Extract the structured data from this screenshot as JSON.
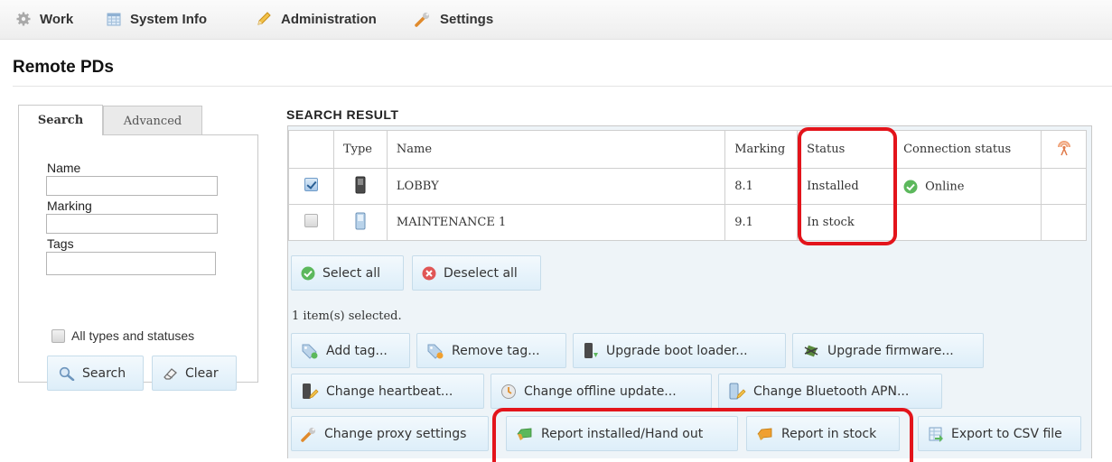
{
  "nav": {
    "items": [
      {
        "label": "Work",
        "icon": "gear-icon"
      },
      {
        "label": "System Info",
        "icon": "calendar-icon"
      },
      {
        "label": "Administration",
        "icon": "pencil-icon"
      },
      {
        "label": "Settings",
        "icon": "wrench-icon"
      }
    ]
  },
  "page": {
    "title": "Remote PDs"
  },
  "search_panel": {
    "tabs": [
      "Search",
      "Advanced"
    ],
    "fields": [
      {
        "label": "Name",
        "value": ""
      },
      {
        "label": "Marking",
        "value": ""
      },
      {
        "label": "Tags",
        "value": ""
      }
    ],
    "all_types_label": "All types and statuses",
    "search_button": "Search",
    "clear_button": "Clear"
  },
  "results": {
    "title": "SEARCH RESULT",
    "columns": [
      "Type",
      "Name",
      "Marking",
      "Status",
      "Connection status"
    ],
    "rows": [
      {
        "checked": true,
        "name": "LOBBY",
        "marking": "8.1",
        "status": "Installed",
        "connection": "Online"
      },
      {
        "checked": false,
        "name": "MAINTENANCE 1",
        "marking": "9.1",
        "status": "In stock",
        "connection": ""
      }
    ],
    "select_all": "Select all",
    "deselect_all": "Deselect all",
    "selected_text": "1 item(s) selected.",
    "actions": {
      "add_tag": "Add tag...",
      "remove_tag": "Remove tag...",
      "upgrade_boot": "Upgrade boot loader...",
      "upgrade_firmware": "Upgrade firmware...",
      "change_heartbeat": "Change heartbeat...",
      "change_offline": "Change offline update...",
      "change_bluetooth": "Change Bluetooth APN...",
      "change_proxy": "Change proxy settings",
      "report_installed": "Report installed/Hand out",
      "report_stock": "Report in stock",
      "export_csv": "Export to CSV file"
    }
  },
  "colors": {
    "accent": "#e3141b",
    "button_bg": "#ddeef9",
    "online_green": "#5cb85c"
  }
}
